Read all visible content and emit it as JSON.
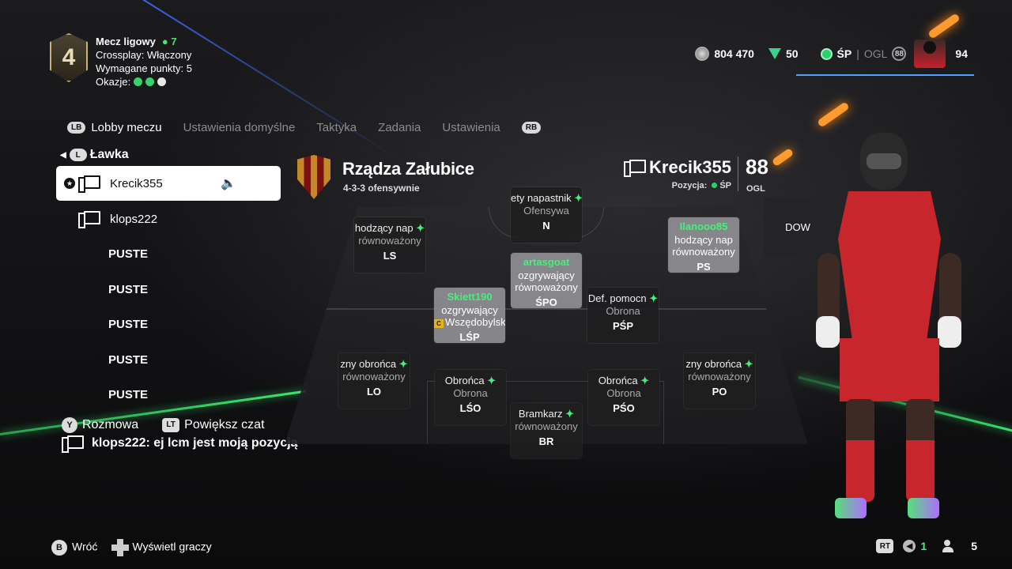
{
  "division": {
    "number": "4",
    "title": "Mecz ligowy",
    "online_count": "7",
    "crossplay": "Crossplay: Włączony",
    "required_points": "Wymagane punkty: 5",
    "chances_label": "Okazje:",
    "chances": [
      "#35d36a",
      "#35d36a",
      "#e6e6e6"
    ]
  },
  "currency": {
    "coins": "804 470",
    "points": "50",
    "status": "ŚP",
    "ovr_label": "OGL",
    "ovr_small": "88",
    "rating": "94"
  },
  "tabs": {
    "left_btn": "LB",
    "right_btn": "RB",
    "items": [
      "Lobby meczu",
      "Ustawienia domyślne",
      "Taktyka",
      "Zadania",
      "Ustawienia"
    ],
    "active": 0
  },
  "lobby": {
    "bench_btn": "L",
    "bench_label": "Ławka",
    "players": [
      {
        "name": "Krecik355",
        "selected": true
      },
      {
        "name": "klops222",
        "selected": false
      }
    ],
    "empty_label": "PUSTE",
    "empty_count": 5
  },
  "chat": {
    "talk_btn": "Y",
    "talk_label": "Rozmowa",
    "expand_btn": "LT",
    "expand_label": "Powiększ czat",
    "message": "klops222: ej lcm jest moją pozycją"
  },
  "club": {
    "name": "Rządza Załubice",
    "formation": "4-3-3 ofensywnie"
  },
  "player": {
    "name": "Krecik355",
    "position_label": "Pozycja:",
    "position": "ŚP",
    "ovr": "88",
    "ovr_label": "OGL"
  },
  "pitch": {
    "cards": [
      {
        "id": "n",
        "pname": "",
        "role": "ety napastnik",
        "style": "Ofensywa",
        "pos": "N",
        "human": false,
        "plus": true,
        "captain": false
      },
      {
        "id": "ls",
        "pname": "",
        "role": "hodzący nap",
        "style": "równoważony",
        "pos": "LS",
        "human": false,
        "plus": true,
        "captain": false
      },
      {
        "id": "ps",
        "pname": "Ilanooo85",
        "role": "hodzący nap",
        "style": "równoważony",
        "pos": "PS",
        "human": true,
        "plus": false,
        "captain": false
      },
      {
        "id": "spo",
        "pname": "artasgoat",
        "role": "ozgrywający",
        "style": "równoważony",
        "pos": "ŚPO",
        "human": true,
        "plus": false,
        "captain": false
      },
      {
        "id": "lsp",
        "pname": "Skiett190",
        "role": "ozgrywający",
        "style": "Wszędobylski",
        "pos": "LŚP",
        "human": true,
        "plus": false,
        "captain": true
      },
      {
        "id": "psp",
        "pname": "",
        "role": "Def. pomocn",
        "style": "Obrona",
        "pos": "PŚP",
        "human": false,
        "plus": true,
        "captain": false
      },
      {
        "id": "lo",
        "pname": "",
        "role": "zny obrońca",
        "style": "równoważony",
        "pos": "LO",
        "human": false,
        "plus": true,
        "captain": false
      },
      {
        "id": "lso",
        "pname": "",
        "role": "Obrońca",
        "style": "Obrona",
        "pos": "LŚO",
        "human": false,
        "plus": true,
        "captain": false
      },
      {
        "id": "pso",
        "pname": "",
        "role": "Obrońca",
        "style": "Obrona",
        "pos": "PŚO",
        "human": false,
        "plus": true,
        "captain": false
      },
      {
        "id": "po",
        "pname": "",
        "role": "zny obrońca",
        "style": "równoważony",
        "pos": "PO",
        "human": false,
        "plus": true,
        "captain": false
      },
      {
        "id": "br",
        "pname": "",
        "role": "Bramkarz",
        "style": "równoważony",
        "pos": "BR",
        "human": false,
        "plus": true,
        "captain": false
      }
    ],
    "dow_label": "DOW"
  },
  "footer": {
    "back_btn": "B",
    "back_label": "Wróć",
    "show_players_label": "Wyświetl graczy",
    "rt_label": "RT",
    "mic_count": "1",
    "players_count": "5"
  }
}
